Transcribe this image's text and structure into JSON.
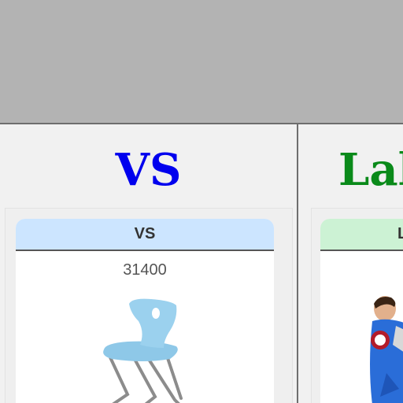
{
  "left": {
    "brand": "VS",
    "card_header": "VS",
    "card_id": "31400",
    "brand_color": "#0000ee",
    "header_color": "#cce5ff"
  },
  "right": {
    "brand": "Lak",
    "card_header": "L",
    "brand_color": "#0a8a1a",
    "header_color": "#ccf2d4"
  }
}
